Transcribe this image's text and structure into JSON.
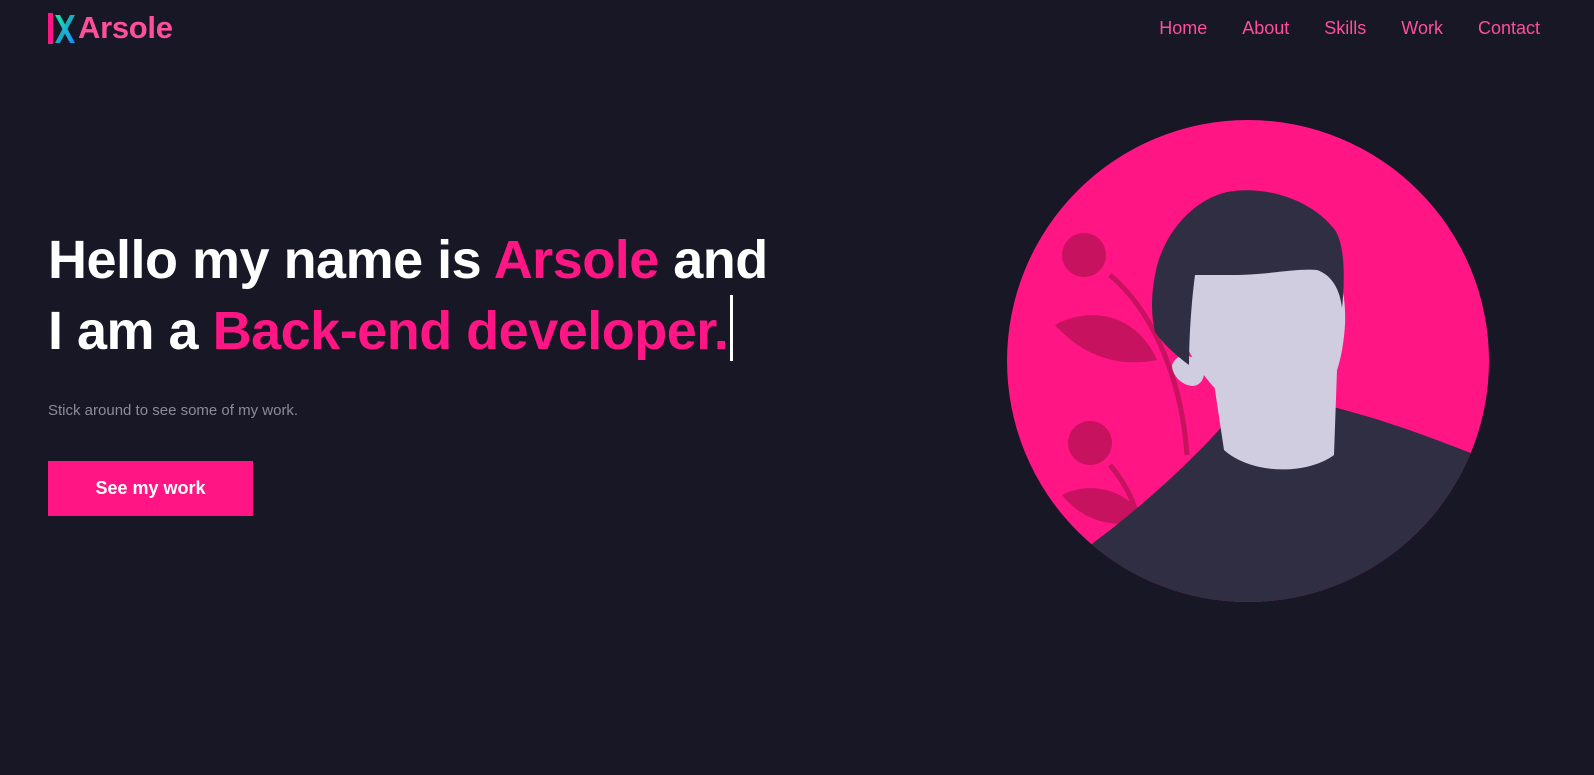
{
  "header": {
    "logo_text": "Arsole",
    "nav": [
      {
        "label": "Home"
      },
      {
        "label": "About"
      },
      {
        "label": "Skills"
      },
      {
        "label": "Work"
      },
      {
        "label": "Contact"
      }
    ]
  },
  "hero": {
    "line1_prefix": "Hello my name is ",
    "name": "Arsole",
    "line1_suffix": " and",
    "line2_prefix": "I am a ",
    "role": "Back-end developer.",
    "subtitle": "Stick around to see some of my work.",
    "cta_label": "See my work"
  },
  "colors": {
    "background": "#171725",
    "accent": "#ff1584",
    "nav_link": "#ff4f9a",
    "text": "#ffffff",
    "muted": "#8c8c99"
  },
  "icons": {
    "logo_mark": "x-logo-icon",
    "illustration": "developer-avatar-illustration"
  }
}
